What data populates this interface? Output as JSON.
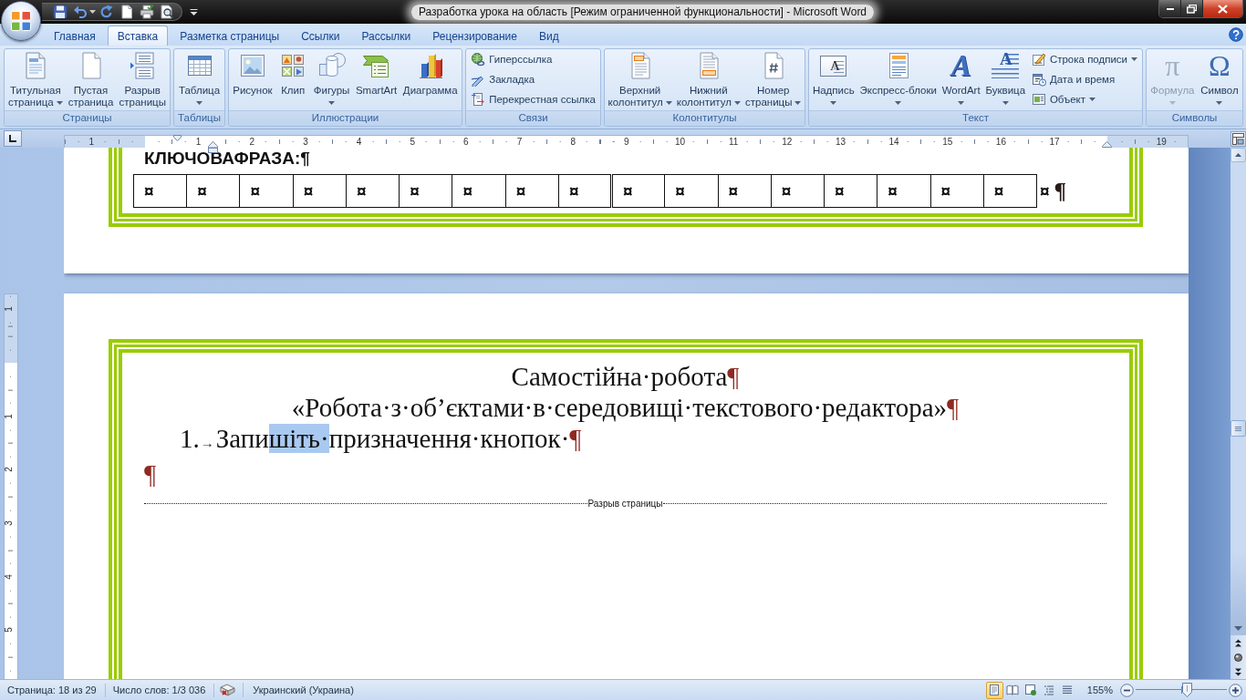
{
  "window": {
    "title": "Разработка урока на область [Режим ограниченной функциональности] - Microsoft Word"
  },
  "tabs": [
    {
      "label": "Главная",
      "selected": false
    },
    {
      "label": "Вставка",
      "selected": true
    },
    {
      "label": "Разметка страницы",
      "selected": false
    },
    {
      "label": "Ссылки",
      "selected": false
    },
    {
      "label": "Рассылки",
      "selected": false
    },
    {
      "label": "Рецензирование",
      "selected": false
    },
    {
      "label": "Вид",
      "selected": false
    }
  ],
  "ribbon": {
    "groups": [
      {
        "label": "Страницы",
        "items": [
          {
            "kind": "large",
            "lines": [
              "Титульная",
              "страница"
            ],
            "dropdown": true,
            "disabled": false
          },
          {
            "kind": "large",
            "lines": [
              "Пустая",
              "страница"
            ],
            "dropdown": false,
            "disabled": false
          },
          {
            "kind": "large",
            "lines": [
              "Разрыв",
              "страницы"
            ],
            "dropdown": false,
            "disabled": false
          }
        ]
      },
      {
        "label": "Таблицы",
        "items": [
          {
            "kind": "large",
            "lines": [
              "Таблица"
            ],
            "dropdown": true,
            "disabled": false
          }
        ]
      },
      {
        "label": "Иллюстрации",
        "items": [
          {
            "kind": "large",
            "lines": [
              "Рисунок"
            ],
            "dropdown": false,
            "disabled": false
          },
          {
            "kind": "large",
            "lines": [
              "Клип"
            ],
            "dropdown": false,
            "disabled": false
          },
          {
            "kind": "large",
            "lines": [
              "Фигуры"
            ],
            "dropdown": true,
            "disabled": false
          },
          {
            "kind": "large",
            "lines": [
              "SmartArt"
            ],
            "dropdown": false,
            "disabled": false
          },
          {
            "kind": "large",
            "lines": [
              "Диаграмма"
            ],
            "dropdown": false,
            "disabled": false
          }
        ]
      },
      {
        "label": "Связи",
        "items": [
          {
            "kind": "small",
            "lines": [
              "Гиперссылка"
            ],
            "dropdown": false,
            "disabled": false
          },
          {
            "kind": "small",
            "lines": [
              "Закладка"
            ],
            "dropdown": false,
            "disabled": false
          },
          {
            "kind": "small",
            "lines": [
              "Перекрестная ссылка"
            ],
            "dropdown": false,
            "disabled": false
          }
        ]
      },
      {
        "label": "Колонтитулы",
        "items": [
          {
            "kind": "large",
            "lines": [
              "Верхний",
              "колонтитул"
            ],
            "dropdown": true,
            "disabled": false
          },
          {
            "kind": "large",
            "lines": [
              "Нижний",
              "колонтитул"
            ],
            "dropdown": true,
            "disabled": false
          },
          {
            "kind": "large",
            "lines": [
              "Номер",
              "страницы"
            ],
            "dropdown": true,
            "disabled": false
          }
        ]
      },
      {
        "label": "Текст",
        "items": [
          {
            "kind": "large",
            "lines": [
              "Надпись"
            ],
            "icon_glyph": "A",
            "dropdown": true,
            "disabled": false
          },
          {
            "kind": "large",
            "lines": [
              "Экспресс-блоки"
            ],
            "dropdown": true,
            "disabled": false
          },
          {
            "kind": "large",
            "lines": [
              "WordArt"
            ],
            "icon_glyph": "A",
            "dropdown": true,
            "disabled": false
          },
          {
            "kind": "large",
            "lines": [
              "Буквица"
            ],
            "icon_glyph": "A",
            "dropdown": true,
            "disabled": false
          },
          {
            "kind": "small",
            "lines": [
              "Строка подписи"
            ],
            "dropdown": true,
            "disabled": false
          },
          {
            "kind": "small",
            "lines": [
              "Дата и время"
            ],
            "dropdown": false,
            "disabled": false
          },
          {
            "kind": "small",
            "lines": [
              "Объект"
            ],
            "dropdown": true,
            "disabled": false
          }
        ]
      },
      {
        "label": "Символы",
        "items": [
          {
            "kind": "large",
            "lines": [
              "Формула"
            ],
            "icon_glyph": "π",
            "dropdown": true,
            "disabled": true
          },
          {
            "kind": "large",
            "lines": [
              "Символ"
            ],
            "icon_glyph": "Ω",
            "dropdown": true,
            "disabled": false
          }
        ]
      }
    ]
  },
  "ruler": {
    "labels": [
      "1",
      "1",
      "2",
      "3",
      "4",
      "5",
      "6",
      "7",
      "8",
      "9",
      "10",
      "11",
      "12",
      "13",
      "14",
      "15",
      "16",
      "17",
      "19"
    ]
  },
  "vertical_ruler": {
    "labels": [
      "1",
      "1",
      "2",
      "3",
      "4",
      "5"
    ]
  },
  "document": {
    "page_1": {
      "heading": {
        "text": "КЛЮЧОВАФРАЗА:",
        "mark": "¶"
      },
      "table": {
        "cells": [
          "¤",
          "¤",
          "¤",
          "¤",
          "¤",
          "¤",
          "¤",
          "¤",
          "¤",
          "¤",
          "¤",
          "¤",
          "¤",
          "¤",
          "¤",
          "¤",
          "¤"
        ],
        "row_end_mark": "¤",
        "mark": "¶"
      }
    },
    "page_2": {
      "title": {
        "text": "Самостійна·робота",
        "mark": "¶"
      },
      "subtitle": {
        "text": "«Робота·з·об’єктами·в·середовищі·текстового·редактора»",
        "mark": "¶"
      },
      "list_item": {
        "number": "1.",
        "tab_mark": "→",
        "runs": [
          {
            "text": "Запи",
            "selected": false
          },
          {
            "text": "шіть·",
            "selected": true
          },
          {
            "text": "призначення·кнопок·",
            "selected": false
          }
        ],
        "mark": "¶"
      },
      "empty_paragraph": {
        "mark": "¶"
      },
      "page_break": {
        "label": "Разрыв страницы"
      }
    }
  },
  "status_bar": {
    "page": "Страница: 18 из 29",
    "words": "Число слов: 1/3 036",
    "language": "Украинский (Украина)",
    "views": [
      {
        "selected": true
      },
      {
        "selected": false
      },
      {
        "selected": false
      },
      {
        "selected": false
      },
      {
        "selected": false
      }
    ],
    "zoom": "155%",
    "zoom_slider": {
      "level": 0.56
    }
  }
}
